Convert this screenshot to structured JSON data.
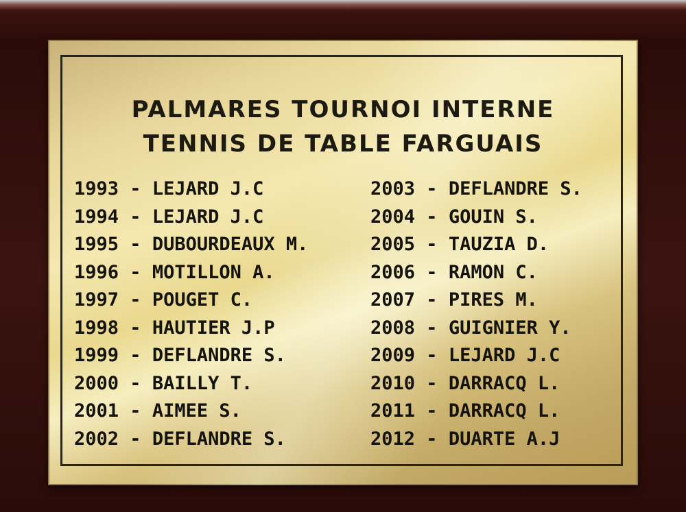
{
  "plaque": {
    "title_line1": "PALMARES TOURNOI INTERNE",
    "title_line2": "TENNIS DE TABLE FARGUAIS",
    "left_column": [
      {
        "year": "1993",
        "sep": " - ",
        "name": "LEJARD J.C"
      },
      {
        "year": "1994",
        "sep": " - ",
        "name": "LEJARD J.C"
      },
      {
        "year": "1995",
        "sep": " - ",
        "name": "DUBOURDEAUX M."
      },
      {
        "year": "1996",
        "sep": " - ",
        "name": "MOTILLON A."
      },
      {
        "year": "1997",
        "sep": " - ",
        "name": "POUGET C."
      },
      {
        "year": "1998",
        "sep": " - ",
        "name": "HAUTIER J.P"
      },
      {
        "year": "1999",
        "sep": " - ",
        "name": "DEFLANDRE S."
      },
      {
        "year": "2000",
        "sep": " - ",
        "name": "BAILLY T."
      },
      {
        "year": "2001",
        "sep": " - ",
        "name": "AIMEE S."
      },
      {
        "year": "2002",
        "sep": " - ",
        "name": "DEFLANDRE S."
      }
    ],
    "right_column": [
      {
        "year": "2003",
        "sep": " - ",
        "name": "DEFLANDRE S."
      },
      {
        "year": "2004",
        "sep": " - ",
        "name": "GOUIN S."
      },
      {
        "year": "2005",
        "sep": " - ",
        "name": "TAUZIA D."
      },
      {
        "year": "2006",
        "sep": " - ",
        "name": "RAMON C."
      },
      {
        "year": "2007",
        "sep": " - ",
        "name": "PIRES M."
      },
      {
        "year": "2008",
        "sep": " - ",
        "name": "GUIGNIER Y."
      },
      {
        "year": "2009",
        "sep": " - ",
        "name": "LEJARD J.C"
      },
      {
        "year": "2010",
        "sep": " - ",
        "name": "DARRACQ L."
      },
      {
        "year": "2011",
        "sep": " - ",
        "name": "DARRACQ L."
      },
      {
        "year": "2012",
        "sep": " - ",
        "name": "DUARTE A.J"
      }
    ]
  }
}
